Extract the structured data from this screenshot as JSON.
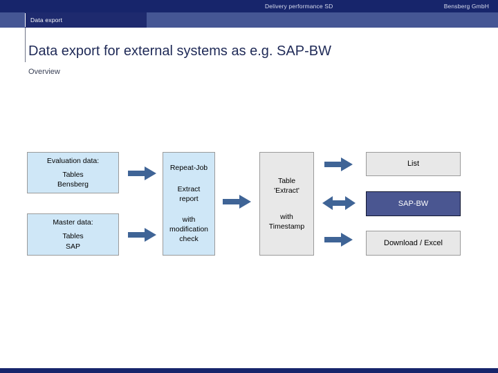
{
  "header": {
    "center_title": "Delivery performance SD",
    "company": "Bensberg GmbH",
    "active_tab": "Data export"
  },
  "title": {
    "heading": "Data export for external systems as e.g. SAP-BW",
    "subheading": "Overview"
  },
  "colors": {
    "header_navy": "#17256b",
    "tabbar_blue": "#455694",
    "active_tab_navy": "#1e2a6e",
    "box_blue_fill": "#cfe7f7",
    "box_gray_fill": "#e8e8e8",
    "box_navy_fill": "#4a5691",
    "box_border": "#9a9a9a",
    "arrow_blue": "#3f6496",
    "title_text": "#1f2a57"
  },
  "diagram": {
    "boxes": {
      "evaluation_data": {
        "line1": "Evaluation data:",
        "line2": "Tables",
        "line3": "Bensberg",
        "style": "blue"
      },
      "master_data": {
        "line1": "Master data:",
        "line2": "Tables",
        "line3": "SAP",
        "style": "blue"
      },
      "repeat_job": {
        "line1": "Repeat-Job",
        "line2": "Extract",
        "line3": "report",
        "line4": "with",
        "line5": "modification",
        "line6": "check",
        "style": "blue"
      },
      "table_extract": {
        "line1": "Table",
        "line2": "'Extract'",
        "line3": "with",
        "line4": "Timestamp",
        "style": "gray"
      },
      "list": {
        "label": "List",
        "style": "gray"
      },
      "sap_bw": {
        "label": "SAP-BW",
        "style": "navy"
      },
      "download_excel": {
        "label": "Download / Excel",
        "style": "gray"
      }
    },
    "arrows": [
      {
        "name": "evaluation-to-repeat",
        "direction": "right"
      },
      {
        "name": "master-to-repeat",
        "direction": "right"
      },
      {
        "name": "repeat-to-extract",
        "direction": "right"
      },
      {
        "name": "extract-to-list",
        "direction": "right"
      },
      {
        "name": "extract-to-sapbw",
        "direction": "both"
      },
      {
        "name": "extract-to-download",
        "direction": "right"
      }
    ]
  }
}
